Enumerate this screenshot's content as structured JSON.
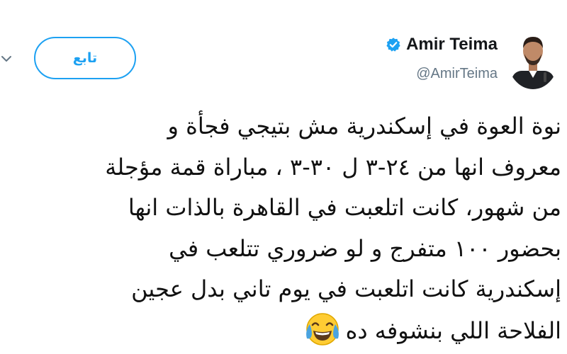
{
  "header": {
    "display_name": "Amir Teima",
    "handle": "@AmirTeima",
    "follow_label": "تابع"
  },
  "icons": {
    "menu": "chevron-down-icon",
    "verified": "verified-badge-icon",
    "emoji": "face-with-tears-of-joy-icon",
    "avatar": "profile-photo"
  },
  "tweet": {
    "lines": [
      "نوة العوة في إسكندرية مش بتيجي  فجأة و",
      "معروف انها من ٢٤-٣ ل ٣٠-٣ ، مباراة قمة مؤجلة",
      "من شهور، كانت اتلعبت في القاهرة بالذات انها",
      "بحضور ١٠٠ متفرج و لو ضروري تتلعب في",
      "إسكندرية كانت اتلعبت في يوم تاني بدل عجين",
      "الفلاحة اللي بنشوفه ده"
    ]
  },
  "colors": {
    "accent": "#1da1f2",
    "text": "#14171a",
    "secondary_text": "#657786",
    "background": "#ffffff"
  }
}
